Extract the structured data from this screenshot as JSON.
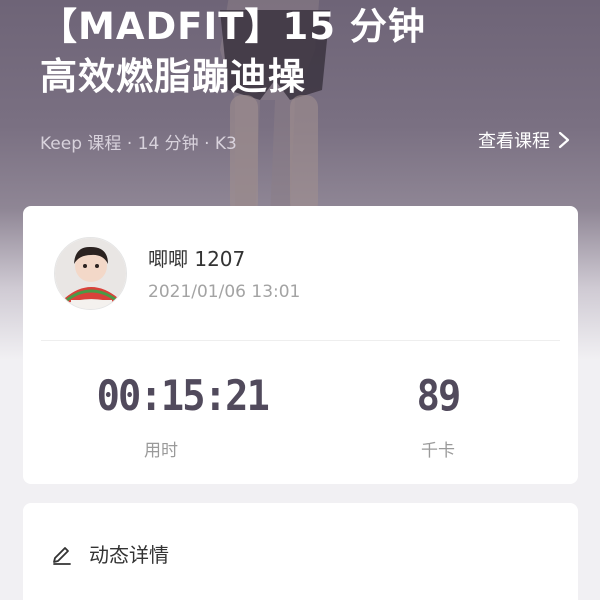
{
  "course": {
    "title_line1": "【MADFIT】15 分钟",
    "title_line2": "高效燃脂蹦迪操",
    "meta": "Keep 课程 · 14 分钟 · K3",
    "view_label": "查看课程"
  },
  "post": {
    "username": "唧唧 1207",
    "timestamp": "2021/01/06 13:01"
  },
  "stats": {
    "duration_value": "00:15:21",
    "duration_label": "用时",
    "calories_value": "89",
    "calories_label": "千卡"
  },
  "detail": {
    "title": "动态详情"
  },
  "colors": {
    "stat_value": "#514a5c",
    "hero_bg": "#6e6477"
  }
}
